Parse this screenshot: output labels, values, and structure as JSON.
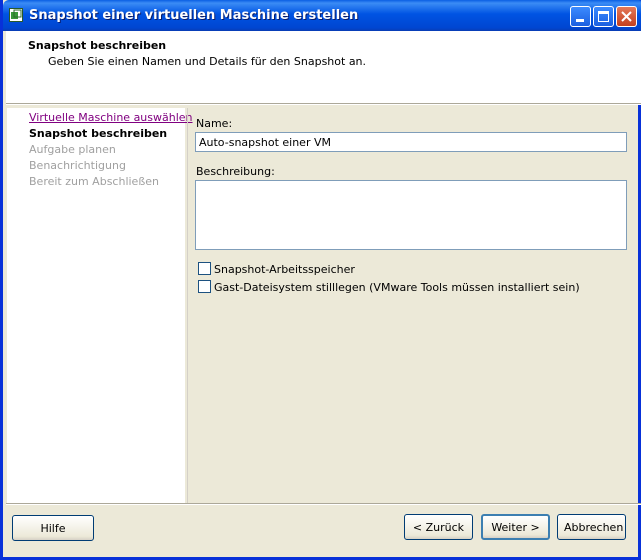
{
  "window": {
    "title": "Snapshot einer virtuellen Maschine erstellen"
  },
  "header": {
    "title": "Snapshot beschreiben",
    "subtitle": "Geben Sie einen Namen und Details für den Snapshot an."
  },
  "nav": {
    "items": [
      {
        "label": "Virtuelle Maschine auswählen",
        "state": "visited"
      },
      {
        "label": "Snapshot beschreiben",
        "state": "current"
      },
      {
        "label": "Aufgabe planen",
        "state": "disabled"
      },
      {
        "label": "Benachrichtigung",
        "state": "disabled"
      },
      {
        "label": "Bereit zum Abschließen",
        "state": "disabled"
      }
    ]
  },
  "form": {
    "name_label": "Name:",
    "name_value": "Auto-snapshot einer VM",
    "description_label": "Beschreibung:",
    "description_value": "",
    "checkbox_memory": {
      "label": "Snapshot-Arbeitsspeicher",
      "checked": false
    },
    "checkbox_quiesce": {
      "label": "Gast-Dateisystem stilllegen (VMware Tools müssen installiert sein)",
      "checked": false
    }
  },
  "footer": {
    "help_label": "Hilfe",
    "back_label": "< Zurück",
    "next_label": "Weiter >",
    "cancel_label": "Abbrechen"
  },
  "colors": {
    "titlebar": "#0054e3",
    "visited_link": "#800080",
    "disabled_text": "#a0a0a0"
  }
}
